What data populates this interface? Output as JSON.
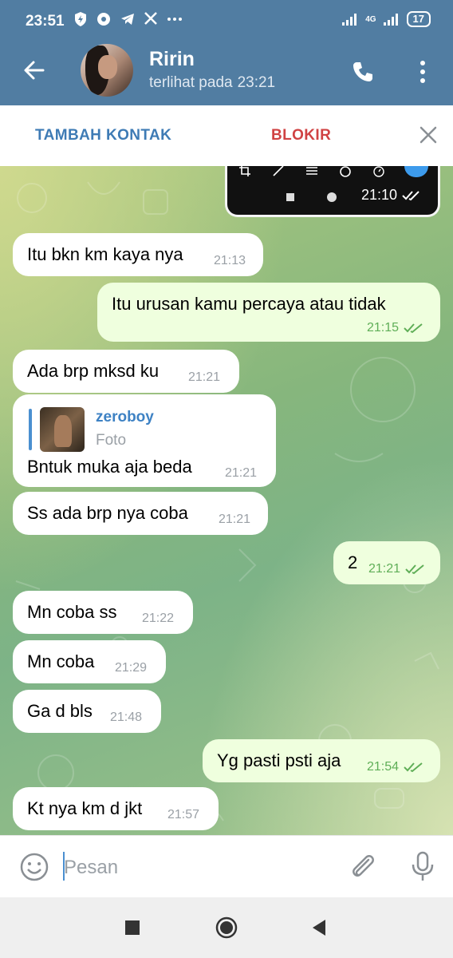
{
  "status_bar": {
    "time": "23:51",
    "network": "4G",
    "battery": "17"
  },
  "header": {
    "name": "Ririn",
    "last_seen_label": "terlihat pada",
    "last_seen_time": "23:21"
  },
  "action_bar": {
    "add_contact": "TAMBAH KONTAK",
    "block": "BLOKIR"
  },
  "messages": [
    {
      "dir": "out",
      "kind": "media",
      "time": "21:10",
      "status": "read"
    },
    {
      "dir": "in",
      "text": "Itu bkn km kaya nya",
      "time": "21:13"
    },
    {
      "dir": "out",
      "text": "Itu urusan kamu percaya atau tidak",
      "time": "21:15",
      "status": "read"
    },
    {
      "dir": "in",
      "text": "Ada brp mksd ku",
      "time": "21:21"
    },
    {
      "dir": "in",
      "text": "Bntuk muka aja beda",
      "time": "21:21",
      "reply_to": {
        "name": "zeroboy",
        "type": "Foto"
      }
    },
    {
      "dir": "in",
      "text": "Ss ada brp nya coba",
      "time": "21:21"
    },
    {
      "dir": "out",
      "text": "2",
      "time": "21:21",
      "status": "read"
    },
    {
      "dir": "in",
      "text": "Mn coba ss",
      "time": "21:22"
    },
    {
      "dir": "in",
      "text": "Mn coba",
      "time": "21:29"
    },
    {
      "dir": "in",
      "text": "Ga d bls",
      "time": "21:48"
    },
    {
      "dir": "out",
      "text": "Yg pasti psti aja",
      "time": "21:54",
      "status": "read"
    },
    {
      "dir": "in",
      "text": "Kt nya km d jkt",
      "time": "21:57"
    }
  ],
  "composer": {
    "placeholder": "Pesan"
  },
  "colors": {
    "header": "#517da2",
    "incoming_bubble": "#ffffff",
    "outgoing_bubble": "#efffde",
    "outgoing_time": "#5fae57",
    "link_blue": "#3e7bb5",
    "block_red": "#d04243"
  },
  "icons": [
    "back-arrow-icon",
    "phone-icon",
    "more-vertical-icon",
    "close-icon",
    "emoji-icon",
    "attach-icon",
    "mic-icon",
    "double-check-icon"
  ]
}
